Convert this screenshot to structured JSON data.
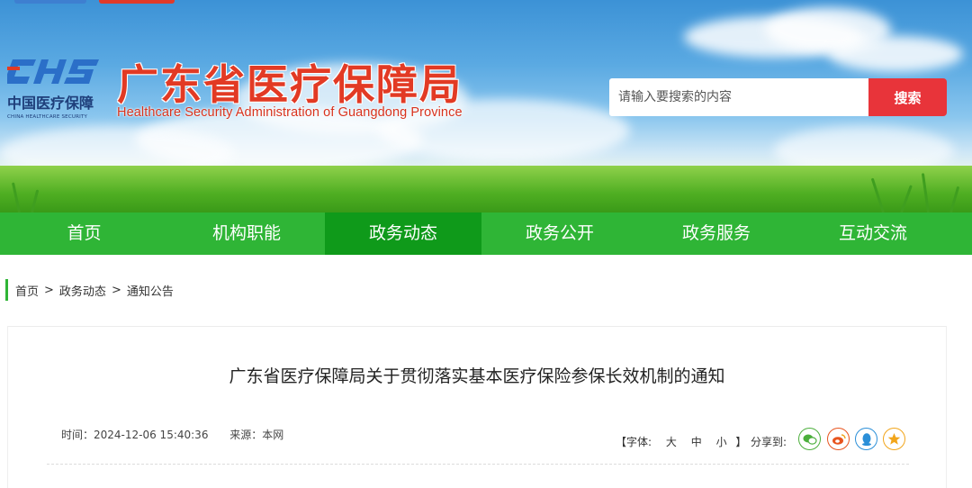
{
  "header": {
    "logo_cn": "中国医疗保障",
    "logo_en": "CHINA HEALTHCARE SECURITY",
    "title_cn": "广东省医疗保障局",
    "title_en": "Healthcare Security Administration of Guangdong Province"
  },
  "search": {
    "placeholder": "请输入要搜索的内容",
    "button_label": "搜索"
  },
  "nav": {
    "items": [
      {
        "label": "首页"
      },
      {
        "label": "机构职能"
      },
      {
        "label": "政务动态"
      },
      {
        "label": "政务公开"
      },
      {
        "label": "政务服务"
      },
      {
        "label": "互动交流"
      }
    ],
    "active": "政务动态"
  },
  "breadcrumb": {
    "items": [
      "首页",
      "政务动态",
      "通知公告"
    ],
    "separator": ">"
  },
  "article": {
    "title": "广东省医疗保障局关于贯彻落实基本医疗保险参保长效机制的通知",
    "time": "时间：2024-12-06 15:40:36",
    "source": "来源：本网",
    "font_label": "【字体:",
    "font_sizes": [
      "大",
      "中",
      "小"
    ],
    "font_close": "】",
    "share_label": "分享到:",
    "share_icons": [
      "wechat-icon",
      "weibo-icon",
      "qq-icon",
      "qzone-icon"
    ]
  },
  "colors": {
    "nav_green": "#2fb536",
    "nav_active": "#0f9a1a",
    "title_red": "#e23a24",
    "search_red": "#e8343a",
    "wechat": "#4caf3c",
    "weibo": "#e8541e",
    "qq": "#2b8fd8",
    "qzone": "#f2a51a"
  }
}
